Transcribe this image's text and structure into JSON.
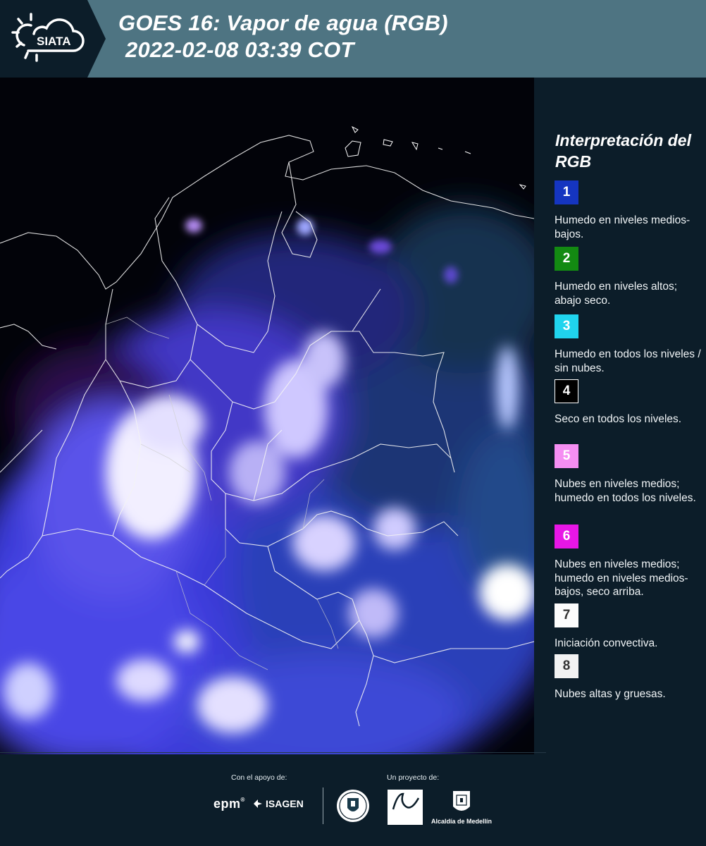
{
  "header": {
    "logo_text": "SIATA",
    "title_line1": "GOES 16: Vapor de agua (RGB)",
    "title_line2": "2022-02-08 03:39 COT"
  },
  "legend": {
    "title": "Interpretación del RGB",
    "items": [
      {
        "number": "1",
        "color": "#1535c0",
        "number_color": "#ffffff",
        "text": "Humedo en niveles medios-bajos."
      },
      {
        "number": "2",
        "color": "#138a12",
        "number_color": "#ffffff",
        "text": "Humedo en niveles altos; abajo seco."
      },
      {
        "number": "3",
        "color": "#20d4ee",
        "number_color": "#ffffff",
        "text": "Humedo en todos los niveles / sin nubes."
      },
      {
        "number": "4",
        "color": "#000000",
        "number_color": "#ffffff",
        "text": "Seco en todos los niveles."
      },
      {
        "number": "5",
        "color": "#f58ef2",
        "number_color": "#ffffff",
        "text": "Nubes en niveles medios; humedo en todos los niveles."
      },
      {
        "number": "6",
        "color": "#e816e6",
        "number_color": "#ffffff",
        "text": "Nubes en niveles medios; humedo en niveles medios-bajos, seco arriba."
      },
      {
        "number": "7",
        "color": "#fcfcfc",
        "number_color": "#333333",
        "text": "Iniciación convectiva."
      },
      {
        "number": "8",
        "color": "#f2f2f2",
        "number_color": "#333333",
        "text": "Nubes altas y gruesas."
      }
    ]
  },
  "footer": {
    "support_caption": "Con el apoyo de:",
    "project_caption": "Un proyecto de:",
    "epm": "epm",
    "isagen": "ISAGEN",
    "alcaldia": "Alcaldía de Medellín"
  }
}
